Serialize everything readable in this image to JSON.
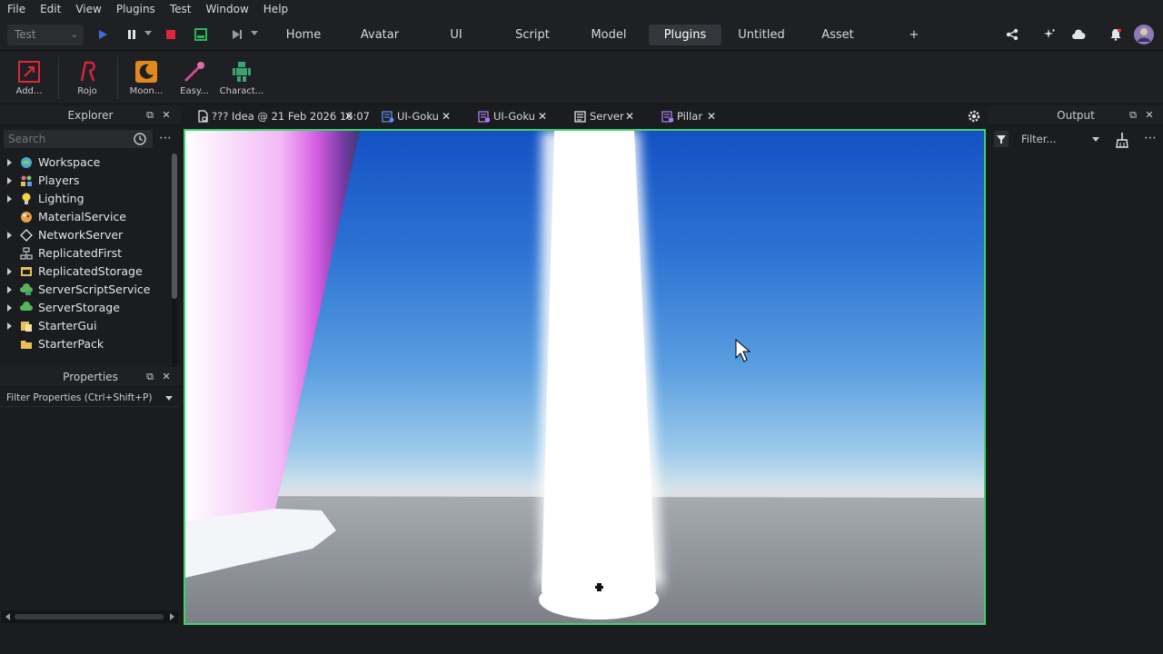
{
  "menu": [
    "File",
    "Edit",
    "View",
    "Plugins",
    "Test",
    "Window",
    "Help"
  ],
  "toolbar": {
    "mode_select": "Test",
    "tabs": [
      {
        "label": "Home",
        "active": false
      },
      {
        "label": "Avatar",
        "active": false
      },
      {
        "label": "UI",
        "active": false
      },
      {
        "label": "Script",
        "active": false
      },
      {
        "label": "Model",
        "active": false
      },
      {
        "label": "Plugins",
        "active": true
      },
      {
        "label": "Untitled",
        "active": false
      },
      {
        "label": "Asset",
        "active": false
      }
    ],
    "add_tab": "+"
  },
  "ribbon": {
    "buttons": [
      {
        "label": "Add...",
        "icon": "add-plugin-icon"
      },
      {
        "label": "Rojo",
        "icon": "rojo-icon"
      },
      {
        "label": "Moon...",
        "icon": "moon-icon"
      },
      {
        "label": "Easy...",
        "icon": "easy-icon"
      },
      {
        "label": "Charact...",
        "icon": "character-icon"
      }
    ]
  },
  "explorer": {
    "title": "Explorer",
    "search_placeholder": "Search",
    "items": [
      {
        "label": "Workspace",
        "expandable": true,
        "icon": "workspace-icon"
      },
      {
        "label": "Players",
        "expandable": true,
        "icon": "players-icon"
      },
      {
        "label": "Lighting",
        "expandable": true,
        "icon": "lighting-icon"
      },
      {
        "label": "MaterialService",
        "expandable": false,
        "icon": "material-service-icon"
      },
      {
        "label": "NetworkServer",
        "expandable": true,
        "icon": "network-server-icon"
      },
      {
        "label": "ReplicatedFirst",
        "expandable": false,
        "icon": "replicated-first-icon"
      },
      {
        "label": "ReplicatedStorage",
        "expandable": true,
        "icon": "replicated-storage-icon"
      },
      {
        "label": "ServerScriptService",
        "expandable": true,
        "icon": "server-script-service-icon"
      },
      {
        "label": "ServerStorage",
        "expandable": true,
        "icon": "server-storage-icon"
      },
      {
        "label": "StarterGui",
        "expandable": true,
        "icon": "starter-gui-icon"
      },
      {
        "label": "StarterPack",
        "expandable": false,
        "icon": "starter-pack-icon"
      }
    ]
  },
  "properties": {
    "title": "Properties",
    "filter_placeholder": "Filter Properties (Ctrl+Shift+P)"
  },
  "doc_tabs": [
    {
      "label": "??? Idea @ 21 Feb 2026 16:07",
      "icon": "document-icon"
    },
    {
      "label": "UI-Goku",
      "icon": "local-script-icon"
    },
    {
      "label": "UI-Goku",
      "icon": "module-script-icon"
    },
    {
      "label": "Server",
      "icon": "script-icon"
    },
    {
      "label": "Pillar",
      "icon": "module-script-icon"
    }
  ],
  "output": {
    "title": "Output",
    "filter_placeholder": "Filter..."
  },
  "colors": {
    "accent_green": "#3bd46e",
    "panel_bg": "#1b1c1f",
    "sky_top": "#1451c3"
  }
}
